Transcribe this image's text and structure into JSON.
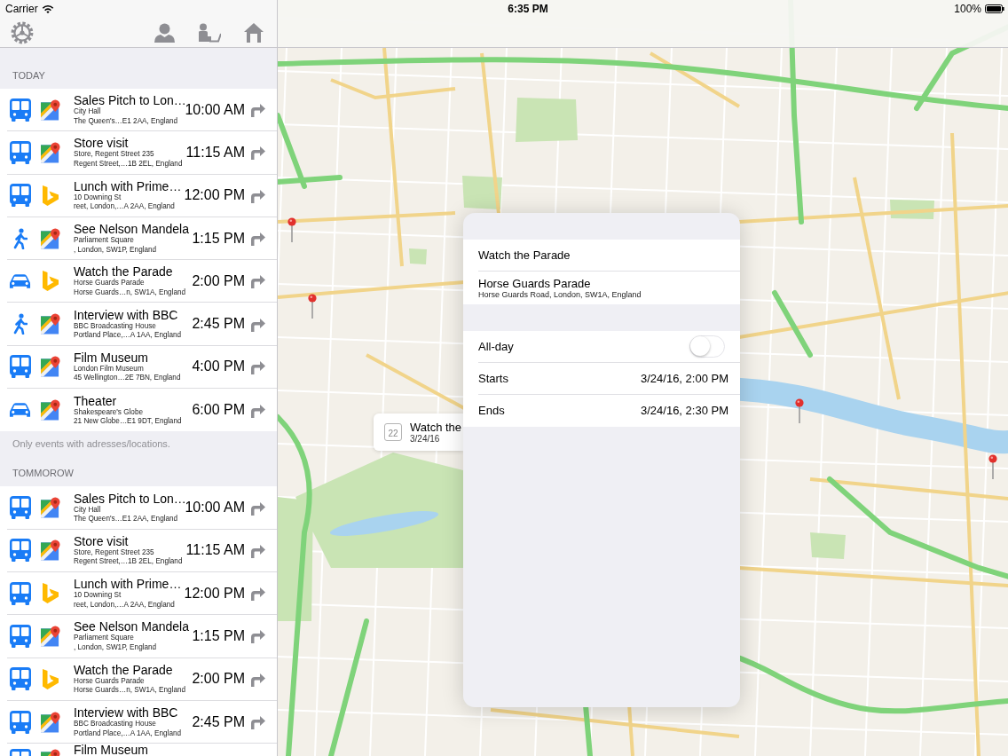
{
  "status_bar": {
    "carrier": "Carrier",
    "time": "6:35 PM",
    "battery": "100%"
  },
  "sidebar": {
    "sections": [
      {
        "header": "TODAY",
        "events": [
          {
            "transport": {
              "kind": "bus"
            },
            "app": {
              "kind": "maps"
            },
            "title": "Sales Pitch to Lon…",
            "place": "City Hall",
            "address": "The Queen's…E1 2AA, England",
            "time": "10:00 AM"
          },
          {
            "transport": {
              "kind": "bus"
            },
            "app": {
              "kind": "maps"
            },
            "title": "Store visit",
            "place": "Store, Regent Street 235",
            "address": "Regent Street,…1B 2EL, England",
            "time": "11:15 AM"
          },
          {
            "transport": {
              "kind": "bus"
            },
            "app": {
              "kind": "bing"
            },
            "title": "Lunch with Prime…",
            "place": "10 Downing St",
            "address": "reet, London,…A 2AA, England",
            "time": "12:00 PM"
          },
          {
            "transport": {
              "kind": "walk"
            },
            "app": {
              "kind": "maps"
            },
            "title": "See Nelson Mandela",
            "place": "Parliament Square",
            "address": ", London, SW1P, England",
            "time": "1:15 PM"
          },
          {
            "transport": {
              "kind": "car"
            },
            "app": {
              "kind": "bing"
            },
            "title": "Watch the Parade",
            "place": "Horse Guards Parade",
            "address": "Horse Guards…n, SW1A, England",
            "time": "2:00 PM"
          },
          {
            "transport": {
              "kind": "walk"
            },
            "app": {
              "kind": "maps"
            },
            "title": "Interview with BBC",
            "place": "BBC Broadcasting House",
            "address": "Portland Place,…A 1AA, England",
            "time": "2:45 PM"
          },
          {
            "transport": {
              "kind": "bus"
            },
            "app": {
              "kind": "maps"
            },
            "title": "Film Museum",
            "place": "London Film Museum",
            "address": "45 Wellington…2E 7BN, England",
            "time": "4:00 PM"
          },
          {
            "transport": {
              "kind": "car"
            },
            "app": {
              "kind": "maps"
            },
            "title": "Theater",
            "place": "Shakespeare's Globe",
            "address": "21 New Globe…E1 9DT, England",
            "time": "6:00 PM"
          }
        ],
        "footer": "Only events with adresses/locations."
      },
      {
        "header": "TOMMOROW",
        "events": [
          {
            "transport": {
              "kind": "bus"
            },
            "app": {
              "kind": "maps"
            },
            "title": "Sales Pitch to Lon…",
            "place": "City Hall",
            "address": "The Queen's…E1 2AA, England",
            "time": "10:00 AM"
          },
          {
            "transport": {
              "kind": "bus"
            },
            "app": {
              "kind": "maps"
            },
            "title": "Store visit",
            "place": "Store, Regent Street 235",
            "address": "Regent Street,…1B 2EL, England",
            "time": "11:15 AM"
          },
          {
            "transport": {
              "kind": "bus"
            },
            "app": {
              "kind": "bing"
            },
            "title": "Lunch with Prime…",
            "place": "10 Downing St",
            "address": "reet, London,…A 2AA, England",
            "time": "12:00 PM"
          },
          {
            "transport": {
              "kind": "bus"
            },
            "app": {
              "kind": "maps"
            },
            "title": "See Nelson Mandela",
            "place": "Parliament Square",
            "address": ", London, SW1P, England",
            "time": "1:15 PM"
          },
          {
            "transport": {
              "kind": "bus"
            },
            "app": {
              "kind": "bing"
            },
            "title": "Watch the Parade",
            "place": "Horse Guards Parade",
            "address": "Horse Guards…n, SW1A, England",
            "time": "2:00 PM"
          },
          {
            "transport": {
              "kind": "bus"
            },
            "app": {
              "kind": "maps"
            },
            "title": "Interview with BBC",
            "place": "BBC Broadcasting House",
            "address": "Portland Place,…A 1AA, England",
            "time": "2:45 PM"
          },
          {
            "transport": {
              "kind": "bus"
            },
            "app": {
              "kind": "maps"
            },
            "title": "Film Museum"
          }
        ]
      }
    ]
  },
  "map_callout": {
    "date_badge": "22",
    "title": "Watch the",
    "date": "3/24/16"
  },
  "event_detail": {
    "title": "Watch the Parade",
    "location_name": "Horse Guards Parade",
    "location_address": "Horse Guards Road, London, SW1A, England",
    "all_day_label": "All-day",
    "all_day": false,
    "starts_label": "Starts",
    "starts": "3/24/16, 2:00 PM",
    "ends_label": "Ends",
    "ends": "3/24/16, 2:30 PM"
  }
}
